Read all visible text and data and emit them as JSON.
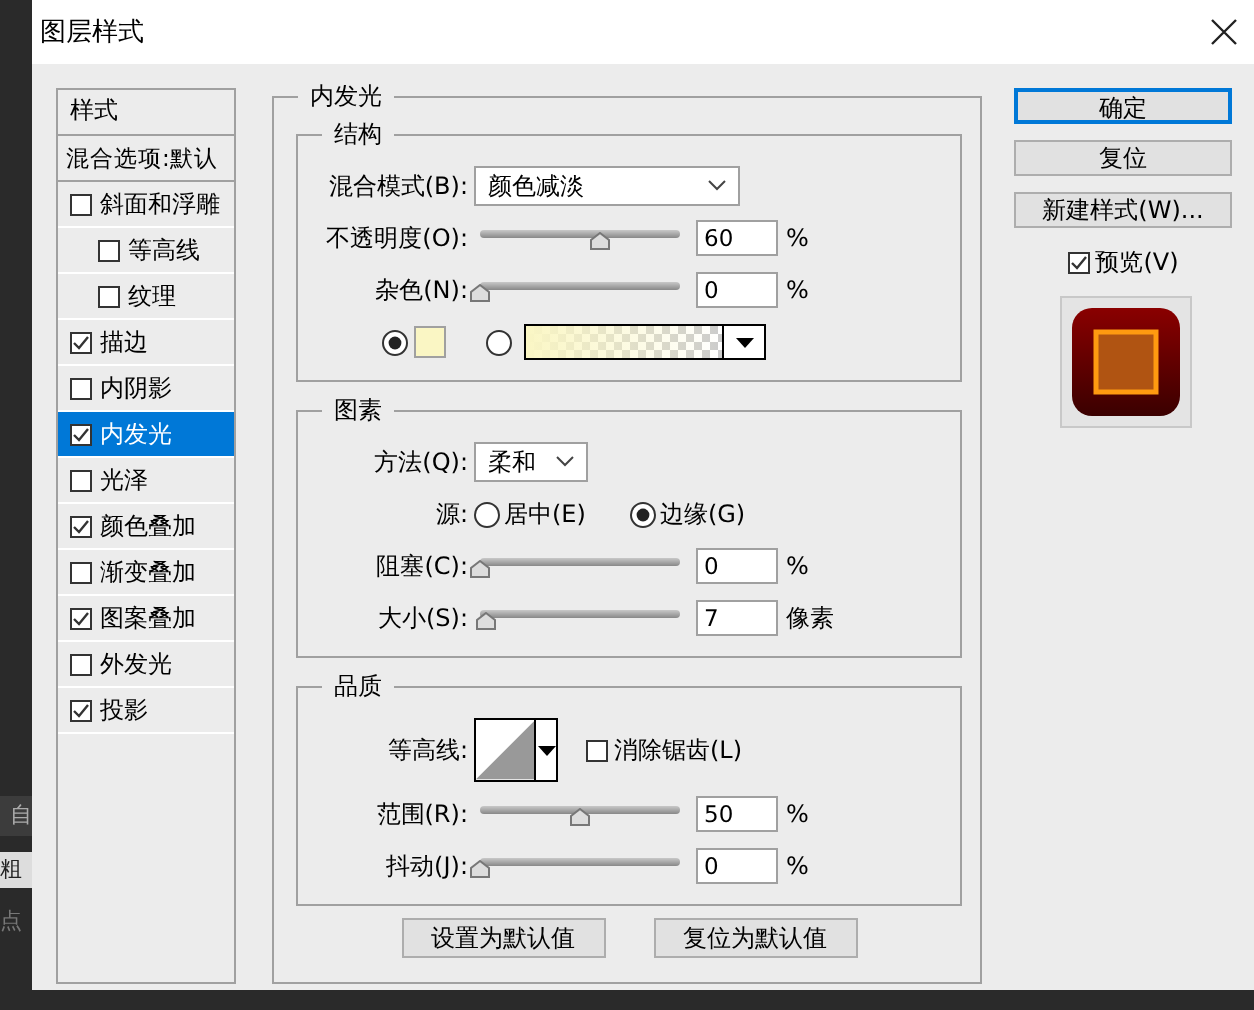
{
  "background": {
    "tab": "自",
    "field": "粗",
    "text": "点"
  },
  "window": {
    "title": "图层样式"
  },
  "styles_list": {
    "header": "样式",
    "blending": "混合选项:默认",
    "items": [
      {
        "label": "斜面和浮雕",
        "checked": false,
        "selected": false,
        "children": [
          {
            "label": "等高线",
            "checked": false,
            "selected": false
          },
          {
            "label": "纹理",
            "checked": false,
            "selected": false
          }
        ]
      },
      {
        "label": "描边",
        "checked": true,
        "selected": false
      },
      {
        "label": "内阴影",
        "checked": false,
        "selected": false
      },
      {
        "label": "内发光",
        "checked": true,
        "selected": true
      },
      {
        "label": "光泽",
        "checked": false,
        "selected": false
      },
      {
        "label": "颜色叠加",
        "checked": true,
        "selected": false
      },
      {
        "label": "渐变叠加",
        "checked": false,
        "selected": false
      },
      {
        "label": "图案叠加",
        "checked": true,
        "selected": false
      },
      {
        "label": "外发光",
        "checked": false,
        "selected": false
      },
      {
        "label": "投影",
        "checked": true,
        "selected": false
      }
    ]
  },
  "panel": {
    "title": "内发光",
    "structure": {
      "title": "结构",
      "blend_mode": {
        "label": "混合模式(B):",
        "value": "颜色减淡"
      },
      "opacity": {
        "label": "不透明度(O):",
        "level": 0.6,
        "value": "60",
        "unit": "%"
      },
      "noise": {
        "label": "杂色(N):",
        "level": 0,
        "value": "0",
        "unit": "%"
      },
      "fill": [
        {
          "kind": "swatch",
          "selected": true,
          "color": "#faf6c4"
        },
        {
          "kind": "gradient",
          "selected": false,
          "color": "#faf6c4"
        }
      ]
    },
    "elements": {
      "title": "图素",
      "method": {
        "label": "方法(Q):",
        "value": "柔和"
      },
      "source": {
        "label": "源:",
        "options": [
          {
            "label": "居中(E)",
            "selected": false
          },
          {
            "label": "边缘(G)",
            "selected": true
          }
        ]
      },
      "choke": {
        "label": "阻塞(C):",
        "level": 0,
        "value": "0",
        "unit": "%"
      },
      "size": {
        "label": "大小(S):",
        "level": 0.03,
        "value": "7",
        "unit": "像素"
      }
    },
    "quality": {
      "title": "品质",
      "contour": {
        "label": "等高线:"
      },
      "anti_alias": {
        "label": "消除锯齿(L)",
        "checked": false
      },
      "range": {
        "label": "范围(R):",
        "level": 0.5,
        "value": "50",
        "unit": "%"
      },
      "jitter": {
        "label": "抖动(J):",
        "level": 0,
        "value": "0",
        "unit": "%"
      }
    },
    "buttons": [
      "设置为默认值",
      "复位为默认值"
    ]
  },
  "actions": [
    {
      "label": "确定",
      "default": true
    },
    {
      "label": "复位",
      "default": false
    },
    {
      "label": "新建样式(W)...",
      "default": false
    }
  ],
  "preview": {
    "label": "预览(V)",
    "checked": true
  }
}
